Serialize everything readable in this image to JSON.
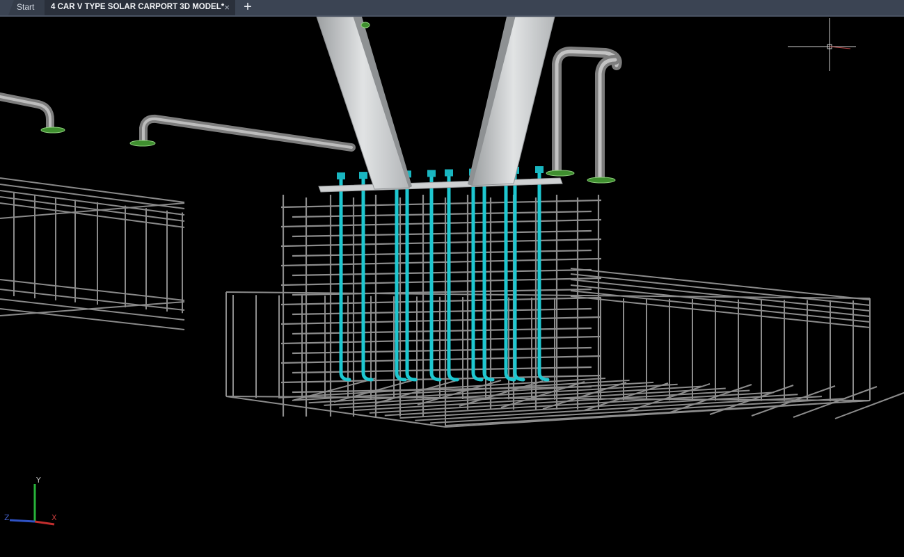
{
  "tabs": {
    "start_label": "Start",
    "document_label": "4 CAR V TYPE SOLAR CARPORT 3D MODEL*",
    "close_glyph": "×",
    "new_tab_glyph": "+"
  },
  "viewport": {
    "background": "#000000",
    "colors": {
      "rebar": "#8a8a8a",
      "anchor_bolt": "#1ec7d0",
      "steel": "#c9cbcc",
      "pipe": "#9a9a9a",
      "clamp": "#3f8f2f"
    }
  },
  "ucs_icon": {
    "y_label": "Y",
    "x_label": "X",
    "z_label": "Z"
  }
}
